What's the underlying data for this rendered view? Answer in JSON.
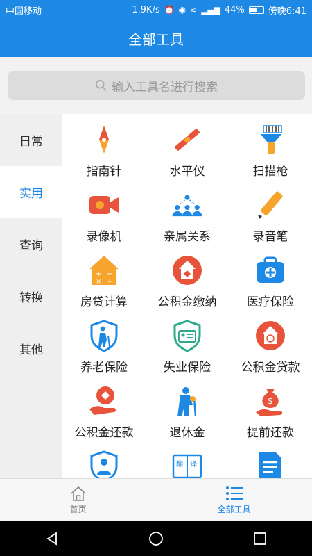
{
  "status": {
    "carrier": "中国移动",
    "speed": "1.9K/s",
    "signal": "46",
    "battery": "44%",
    "time": "傍晚6:41"
  },
  "header": {
    "title": "全部工具"
  },
  "search": {
    "placeholder": "输入工具名进行搜索",
    "icon": "search-icon"
  },
  "sidebar": {
    "items": [
      {
        "label": "日常",
        "active": false
      },
      {
        "label": "实用",
        "active": true
      },
      {
        "label": "查询",
        "active": false
      },
      {
        "label": "转换",
        "active": false
      },
      {
        "label": "其他",
        "active": false
      }
    ]
  },
  "tools": [
    {
      "label": "指南针",
      "icon": "compass-icon"
    },
    {
      "label": "水平仪",
      "icon": "level-icon"
    },
    {
      "label": "扫描枪",
      "icon": "scanner-icon"
    },
    {
      "label": "录像机",
      "icon": "video-camera-icon"
    },
    {
      "label": "亲属关系",
      "icon": "family-icon"
    },
    {
      "label": "录音笔",
      "icon": "pen-icon"
    },
    {
      "label": "房贷计算",
      "icon": "house-calculator-icon"
    },
    {
      "label": "公积金缴纳",
      "icon": "fund-payment-icon"
    },
    {
      "label": "医疗保险",
      "icon": "medical-bag-icon"
    },
    {
      "label": "养老保险",
      "icon": "elder-shield-icon"
    },
    {
      "label": "失业保险",
      "icon": "unemployment-shield-icon"
    },
    {
      "label": "公积金贷款",
      "icon": "fund-loan-icon"
    },
    {
      "label": "公积金还款",
      "icon": "fund-repay-icon"
    },
    {
      "label": "退休金",
      "icon": "pension-icon"
    },
    {
      "label": "提前还款",
      "icon": "money-bag-icon"
    },
    {
      "label": "",
      "icon": "profile-shield-icon"
    },
    {
      "label": "",
      "icon": "translate-book-icon"
    },
    {
      "label": "",
      "icon": "document-icon"
    }
  ],
  "tabbar": {
    "items": [
      {
        "label": "首页",
        "icon": "home-icon",
        "active": false
      },
      {
        "label": "全部工具",
        "icon": "list-icon",
        "active": true
      }
    ]
  },
  "colors": {
    "primary": "#1e88e5",
    "accent": "#e8533b",
    "orange": "#f6a42c"
  }
}
